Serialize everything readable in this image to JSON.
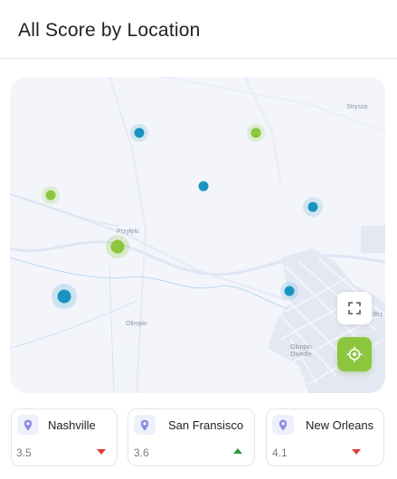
{
  "header": {
    "title": "All Score by Location"
  },
  "map": {
    "place_labels": [
      "Strysza",
      "Przyłęki",
      "Olimpin",
      "Olimpin Osiedle",
      "Brz"
    ],
    "colors": {
      "green": "#8cc63f",
      "blue": "#1a93c0"
    },
    "controls": {
      "fullscreen_icon": "fullscreen-icon",
      "locate_icon": "crosshair-icon"
    }
  },
  "locations": [
    {
      "name": "Nashville",
      "score": "3.5",
      "trend": "down"
    },
    {
      "name": "San Fransisco",
      "score": "3.6",
      "trend": "up"
    },
    {
      "name": "New Orleans",
      "score": "4.1",
      "trend": "down"
    }
  ]
}
